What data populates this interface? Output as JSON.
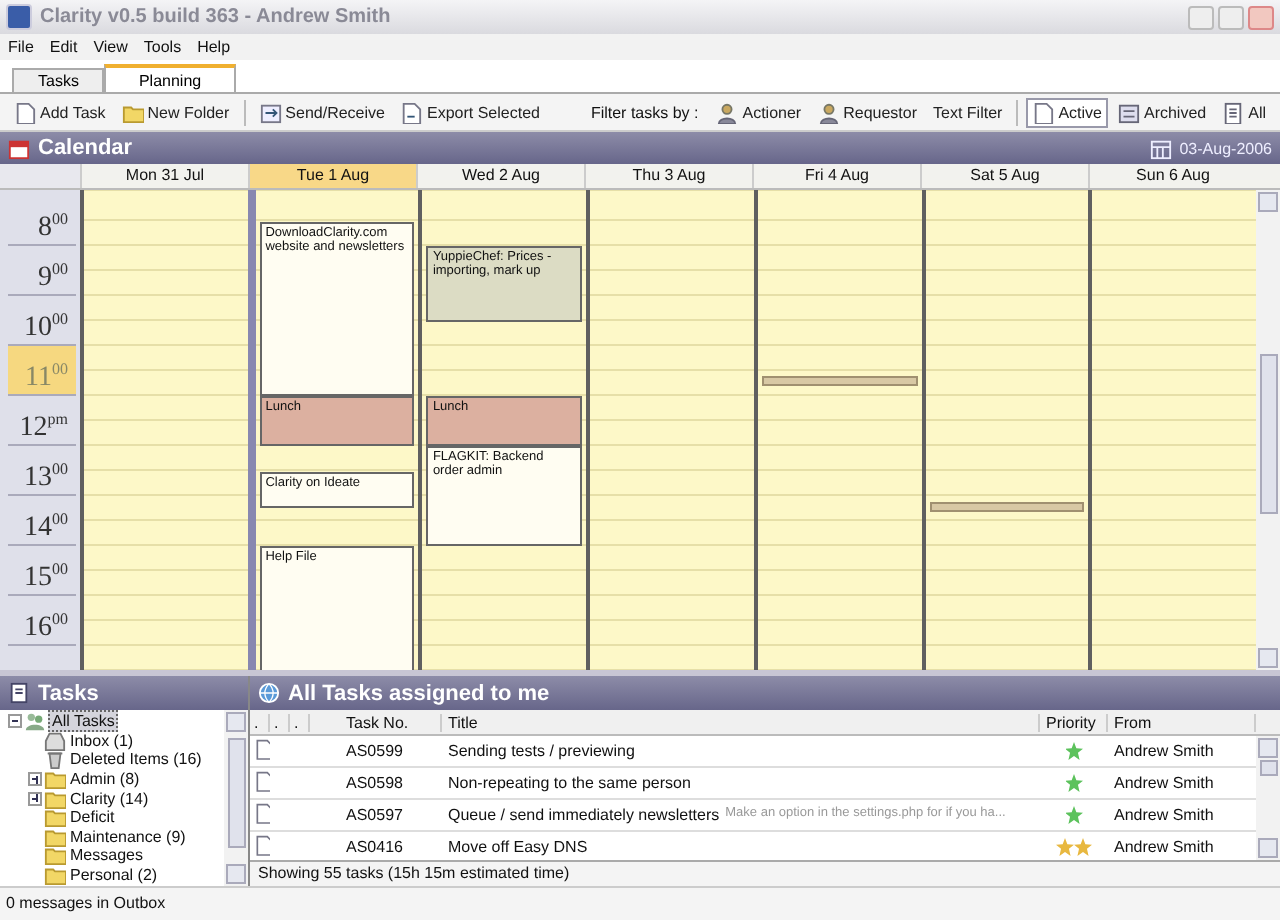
{
  "window": {
    "title": "Clarity v0.5 build 363 - Andrew Smith"
  },
  "menu": [
    "File",
    "Edit",
    "View",
    "Tools",
    "Help"
  ],
  "tabs": [
    {
      "label": "Tasks",
      "selected": false
    },
    {
      "label": "Planning",
      "selected": true
    }
  ],
  "toolbar": {
    "left": [
      {
        "label": "Add Task",
        "kind": "page"
      },
      {
        "label": "New Folder",
        "kind": "folder"
      },
      {
        "label": "Send/Receive",
        "kind": "sync"
      },
      {
        "label": "Export Selected",
        "kind": "export"
      }
    ],
    "filter_label": "Filter tasks by :",
    "filters": [
      {
        "label": "Actioner",
        "kind": "person"
      },
      {
        "label": "Requestor",
        "kind": "person"
      },
      {
        "label": "Text Filter",
        "kind": "blank"
      }
    ],
    "views": [
      {
        "label": "Active",
        "selected": true,
        "kind": "page"
      },
      {
        "label": "Archived",
        "selected": false,
        "kind": "archive"
      },
      {
        "label": "All",
        "selected": false,
        "kind": "list"
      }
    ]
  },
  "calendar": {
    "title": "Calendar",
    "date": "03-Aug-2006",
    "hours": [
      {
        "label": "8$^{00}$",
        "current": false
      },
      {
        "label": "9$^{00}$",
        "current": false
      },
      {
        "label": "10$^{00}$",
        "current": false
      },
      {
        "label": "11$^{00}$",
        "current": true
      },
      {
        "label": "12$^{pm}$",
        "current": false
      },
      {
        "label": "13$^{00}$",
        "current": false
      },
      {
        "label": "14$^{00}$",
        "current": false
      },
      {
        "label": "15$^{00}$",
        "current": false
      },
      {
        "label": "16$^{00}$",
        "current": false
      }
    ],
    "days": [
      {
        "label": "Mon 31 Jul",
        "selected": false
      },
      {
        "label": "Tue 1 Aug",
        "selected": true,
        "events": [
          {
            "title": "DownloadClarity.com website and newsletters",
            "color": "#fffdf2"
          },
          {
            "title": "Lunch",
            "color": "#dcb0a0"
          },
          {
            "title": "Clarity on Ideate",
            "color": "#fffdf2"
          },
          {
            "title": "Help File",
            "color": "#fffdf2"
          }
        ]
      },
      {
        "label": "Wed 2 Aug",
        "selected": false,
        "events": [
          {
            "title": "YuppieChef: Prices - importing, mark up",
            "color": "#dcdcc4"
          },
          {
            "title": "Lunch",
            "color": "#dcb0a0"
          },
          {
            "title": "FLAGKIT: Backend order admin",
            "color": "#fffdf2"
          }
        ]
      },
      {
        "label": "Thu 3 Aug",
        "selected": false
      },
      {
        "label": "Fri 4 Aug",
        "selected": false,
        "events": [
          {
            "color": "#d8c8a4"
          }
        ]
      },
      {
        "label": "Sat 5 Aug",
        "selected": false,
        "events": [
          {
            "color": "#d8c8a4"
          }
        ]
      },
      {
        "label": "Sun 6 Aug",
        "selected": false
      }
    ]
  },
  "tasks_panel": {
    "title": "Tasks",
    "tree": [
      {
        "label": "All Tasks",
        "selected": true,
        "expanded": true,
        "kind": "root",
        "children": [
          {
            "label": "Inbox (1)",
            "selected": false,
            "kind": "inbox"
          },
          {
            "label": "Deleted Items (16)",
            "selected": false,
            "kind": "trash"
          },
          {
            "label": "Admin (8)",
            "selected": false,
            "expanded": false,
            "kind": "folder"
          },
          {
            "label": "Clarity (14)",
            "selected": false,
            "expanded": false,
            "kind": "folder"
          },
          {
            "label": "Deficit",
            "selected": false,
            "kind": "folder"
          },
          {
            "label": "Maintenance (9)",
            "selected": false,
            "kind": "folder"
          },
          {
            "label": "Messages",
            "selected": false,
            "kind": "folder"
          },
          {
            "label": "Personal (2)",
            "selected": false,
            "kind": "folder"
          }
        ]
      }
    ]
  },
  "task_list": {
    "title": "All Tasks assigned to me",
    "columns": [
      ".",
      ".",
      ".",
      "Task No.",
      "Title",
      "Priority",
      "From"
    ],
    "rows": [
      {
        "task_no": "AS0599",
        "title": "Sending tests / previewing",
        "high_priority": false,
        "from": "Andrew Smith"
      },
      {
        "task_no": "AS0598",
        "title": "Non-repeating to the same person",
        "high_priority": false,
        "from": "Andrew Smith"
      },
      {
        "task_no": "AS0597",
        "title": "Queue / send immediately newsletters",
        "note": "Make an option in the settings.php for if you ha...",
        "high_priority": false,
        "from": "Andrew Smith"
      },
      {
        "task_no": "AS0416",
        "title": "Move off Easy DNS",
        "high_priority": true,
        "from": "Andrew Smith"
      }
    ],
    "footer": "Showing 55 tasks (15h 15m estimated time)"
  },
  "status_bar": "0 messages in Outbox"
}
